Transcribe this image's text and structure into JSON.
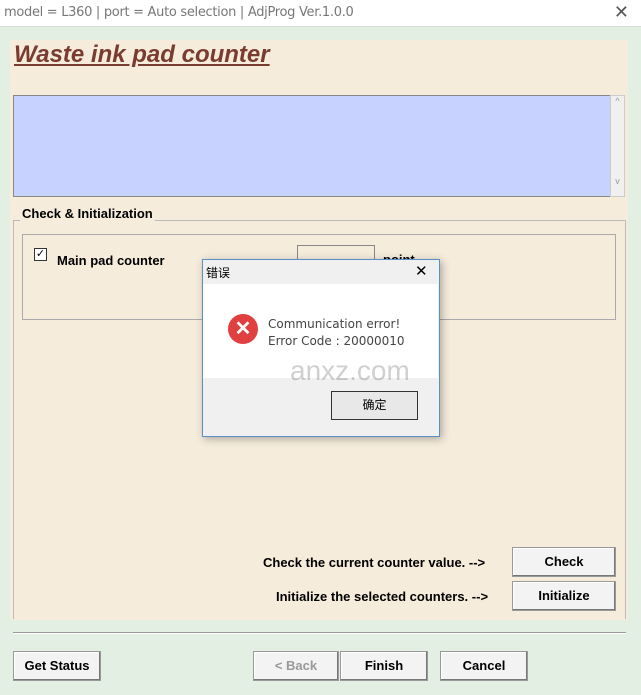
{
  "window": {
    "title": "model = L360 | port = Auto selection | AdjProg Ver.1.0.0",
    "close": "✕"
  },
  "page": {
    "title": "Waste ink pad counter",
    "log_text": ""
  },
  "group": {
    "label": "Check & Initialization",
    "counter_label": "Main pad counter",
    "counter_checked": true,
    "counter_value": "",
    "unit": "point",
    "check_hint": "Check the current counter value. -->",
    "check_button": "Check",
    "init_hint": "Initialize the selected counters. -->",
    "init_button": "Initialize"
  },
  "footer": {
    "get_status": "Get Status",
    "back": "< Back",
    "finish": "Finish",
    "cancel": "Cancel"
  },
  "dialog": {
    "title": "错误",
    "message": "Communication error!",
    "code": "Error Code : 20000010",
    "ok": "确定",
    "close": "✕",
    "watermark": "anxz.com"
  },
  "colors": {
    "title": "#7a3b30",
    "log_bg": "#c8d2ff",
    "panel": "#f5ecdb",
    "window_bg": "#e2efe2"
  }
}
